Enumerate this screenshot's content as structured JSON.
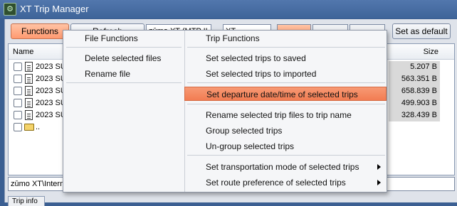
{
  "window": {
    "title": "XT Trip Manager"
  },
  "toolbar": {
    "functions_label": "Functions",
    "refresh_label": "Refresh",
    "device_value": "zūmo XT (MTP II",
    "model_value": "XT",
    "set_default_label": "Set as default"
  },
  "file_list": {
    "col_name": "Name",
    "col_size": "Size",
    "rows": [
      {
        "name": "2023 SU",
        "size": "5.207 B"
      },
      {
        "name": "2023 SU",
        "size": "563.351 B"
      },
      {
        "name": "2023 SU",
        "size": "658.839 B"
      },
      {
        "name": "2023 SU",
        "size": "499.903 B"
      },
      {
        "name": "2023 SU",
        "size": "328.439 B"
      }
    ],
    "parent_folder": ".."
  },
  "path_value": "zūmo XT\\Intern",
  "bottom_tab": "Trip info",
  "context_menu": {
    "left": {
      "header": "File Functions",
      "items": [
        "Delete selected files",
        "Rename file"
      ]
    },
    "right": {
      "header": "Trip Functions",
      "items": [
        "Set selected trips to saved",
        "Set selected trips to imported",
        "Set departure date/time of selected trips",
        "Rename selected trip files to trip name",
        "Group selected trips",
        "Un-group selected trips",
        "Set transportation mode of selected trips",
        "Set route preference of selected trips"
      ],
      "highlighted_index": 2
    }
  },
  "colors": {
    "accent_orange": "#f27c52",
    "title_bar": "#3e6499"
  }
}
